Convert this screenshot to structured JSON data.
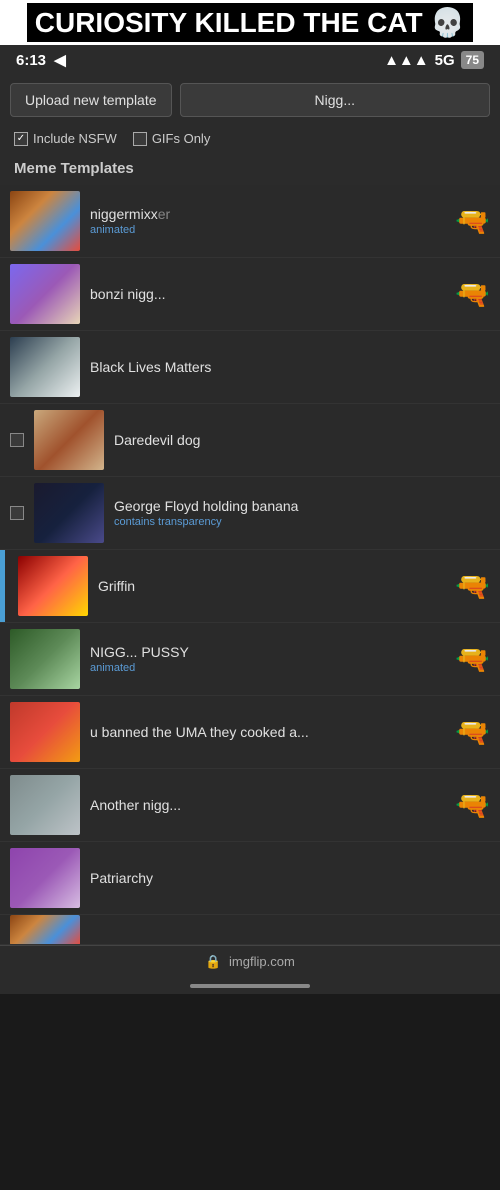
{
  "meme_banner": {
    "text": "CURIOSITY KILLED THE CAT 💀"
  },
  "status_bar": {
    "time": "6:13",
    "signal": "5G",
    "battery": "75"
  },
  "toolbar": {
    "upload_label": "Upload new template",
    "secondary_label": "Nigg..."
  },
  "filters": {
    "nsfw_label": "Include NSFW",
    "nsfw_checked": true,
    "gifs_label": "GIFs Only",
    "gifs_checked": false
  },
  "section": {
    "title": "Meme Templates"
  },
  "templates": [
    {
      "name": "niggermixxer",
      "badge": "animated",
      "badge_type": "animated",
      "thumb_class": "thumb-color-1",
      "has_checkbox": false,
      "has_gun": true
    },
    {
      "name": "bonzi nigg...",
      "badge": "",
      "badge_type": "",
      "thumb_class": "thumb-color-2",
      "has_checkbox": false,
      "has_gun": true
    },
    {
      "name": "Black Lives Matters",
      "badge": "",
      "badge_type": "",
      "thumb_class": "thumb-color-3",
      "has_checkbox": false,
      "has_gun": false
    },
    {
      "name": "Daredevil dog",
      "badge": "",
      "badge_type": "",
      "thumb_class": "thumb-color-4",
      "has_checkbox": true,
      "has_gun": false
    },
    {
      "name": "George Floyd holding banana",
      "badge": "contains transparency",
      "badge_type": "transparency",
      "thumb_class": "thumb-color-5",
      "has_checkbox": true,
      "has_gun": false
    },
    {
      "name": "Griffin",
      "badge": "",
      "badge_type": "",
      "thumb_class": "thumb-color-6",
      "has_checkbox": false,
      "has_gun": true
    },
    {
      "name": "NIGG... PUSSY",
      "badge": "animated",
      "badge_type": "animated",
      "thumb_class": "thumb-color-7",
      "has_checkbox": false,
      "has_gun": true
    },
    {
      "name": "u banned the UMA they cooked a...",
      "badge": "",
      "badge_type": "",
      "thumb_class": "thumb-color-8",
      "has_checkbox": false,
      "has_gun": true
    },
    {
      "name": "Another nigg...",
      "badge": "",
      "badge_type": "",
      "thumb_class": "thumb-color-9",
      "has_checkbox": false,
      "has_gun": true
    },
    {
      "name": "Patriarchy",
      "badge": "",
      "badge_type": "",
      "thumb_class": "thumb-color-10",
      "has_checkbox": false,
      "has_gun": false
    }
  ],
  "bottom_bar": {
    "label": "imgflip.com"
  }
}
